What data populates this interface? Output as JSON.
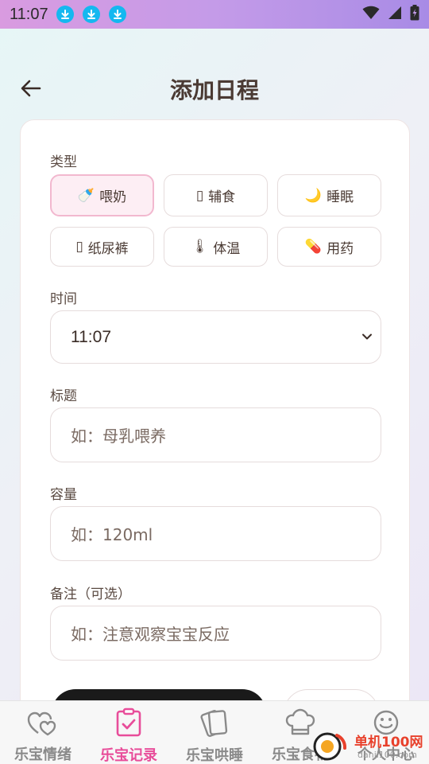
{
  "status_bar": {
    "time": "11:07"
  },
  "header": {
    "title": "添加日程"
  },
  "form": {
    "type_label": "类型",
    "types": [
      {
        "emoji": "🍼",
        "label": "喂奶",
        "active": true
      },
      {
        "emoji": "▯",
        "label": "辅食",
        "active": false
      },
      {
        "emoji": "🌙",
        "label": "睡眠",
        "active": false
      },
      {
        "emoji": "▯",
        "label": "纸尿裤",
        "active": false
      },
      {
        "emoji": "🌡",
        "label": "体温",
        "active": false
      },
      {
        "emoji": "💊",
        "label": "用药",
        "active": false
      }
    ],
    "time_label": "时间",
    "time_value": "11:07",
    "title_label": "标题",
    "title_placeholder": "如：母乳喂养",
    "amount_label": "容量",
    "amount_placeholder": "如：120ml",
    "note_label": "备注（可选）",
    "note_placeholder": "如：注意观察宝宝反应"
  },
  "tabs": [
    {
      "label": "乐宝情绪",
      "icon": "hearts-icon",
      "active": false
    },
    {
      "label": "乐宝记录",
      "icon": "checklist-icon",
      "active": true
    },
    {
      "label": "乐宝哄睡",
      "icon": "cards-icon",
      "active": false
    },
    {
      "label": "乐宝食物",
      "icon": "chef-hat-icon",
      "active": false
    },
    {
      "label": "个人中心",
      "icon": "smiley-icon",
      "active": false
    }
  ],
  "watermark": {
    "text": "单机100网",
    "subtext": "danji100.com"
  },
  "colors": {
    "accent": "#e84d9a",
    "active_bg": "#fdeef4",
    "active_border": "#f2b8cf"
  }
}
